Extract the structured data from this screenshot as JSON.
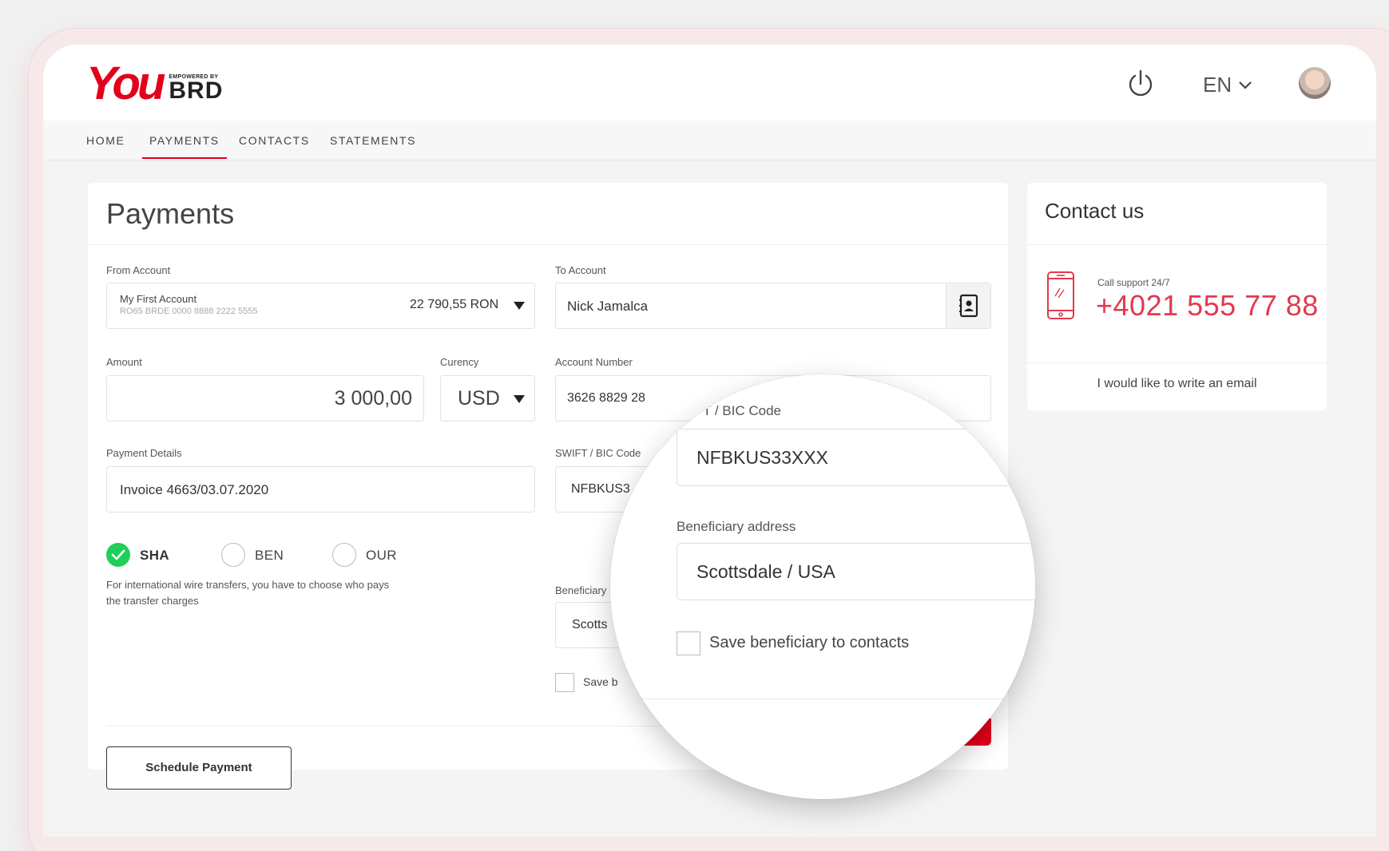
{
  "brand": {
    "logo_word": "You",
    "empowered": "EMPOWERED BY",
    "bank": "BRD"
  },
  "header": {
    "language": "EN"
  },
  "nav": {
    "items": [
      {
        "label": "HOME",
        "active": false
      },
      {
        "label": "PAYMENTS",
        "active": true
      },
      {
        "label": "CONTACTS",
        "active": false
      },
      {
        "label": "STATEMENTS",
        "active": false
      }
    ]
  },
  "payments": {
    "title": "Payments",
    "from_account": {
      "label": "From Account",
      "name": "My First Account",
      "iban": "RO65 BRDE 0000 8888 2222 5555",
      "balance": "22 790,55 RON"
    },
    "to_account": {
      "label": "To Account",
      "value": "Nick Jamalca"
    },
    "amount": {
      "label": "Amount",
      "value": "3 000,00"
    },
    "currency": {
      "label": "Curency",
      "value": "USD"
    },
    "account_number": {
      "label": "Account Number",
      "value": "3626 8829 28"
    },
    "payment_details": {
      "label": "Payment Details",
      "value": "Invoice 4663/03.07.2020"
    },
    "swift": {
      "label": "SWIFT / BIC Code",
      "value_partial": "NFBKUS3"
    },
    "beneficiary": {
      "label_partial": "Beneficiary",
      "value_partial": "Scotts"
    },
    "save_partial": "Save b",
    "charges": {
      "options": [
        {
          "label": "SHA",
          "selected": true
        },
        {
          "label": "BEN",
          "selected": false
        },
        {
          "label": "OUR",
          "selected": false
        }
      ],
      "note": "For international wire transfers, you have to choose who pays the transfer charges"
    },
    "schedule_button": "Schedule Payment"
  },
  "contact": {
    "title": "Contact us",
    "call_label": "Call support 24/7",
    "phone": "+4021 555 77 88",
    "email_link": "I would like to write an email"
  },
  "magnifier": {
    "swift_label_partial": "·FT / BIC Code",
    "swift_value": "NFBKUS33XXX",
    "address_label": "Beneficiary address",
    "address_value": "Scottsdale / USA",
    "save_label": "Save beneficiary to contacts"
  },
  "colors": {
    "brand_red": "#e3001b",
    "phone_red": "#e3394f",
    "success_green": "#1fcf5a"
  }
}
